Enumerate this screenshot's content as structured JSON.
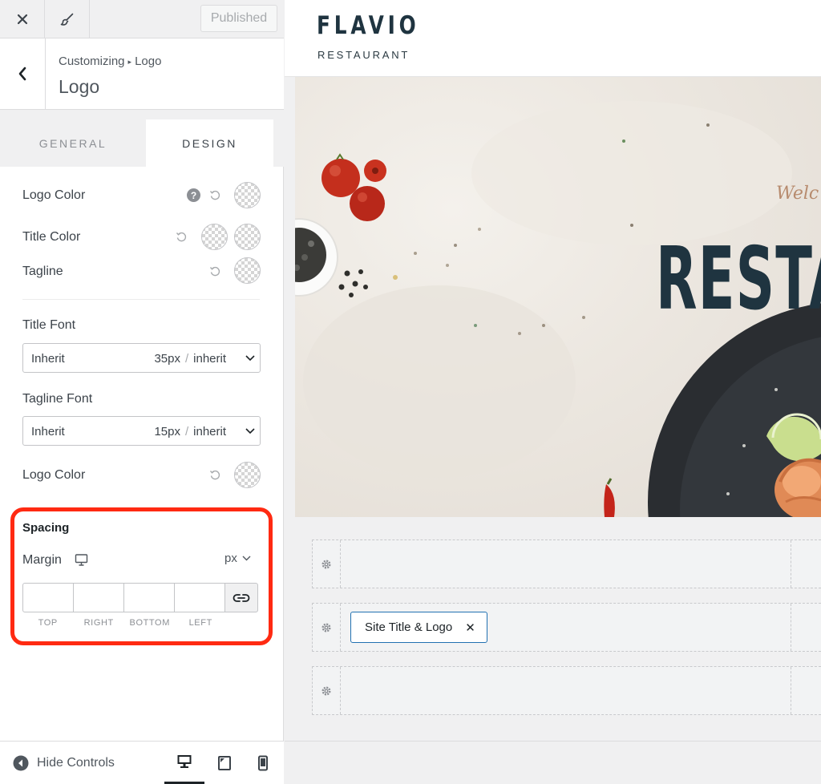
{
  "topbar": {
    "publish_label": "Published"
  },
  "section": {
    "breadcrumb_parent": "Customizing",
    "breadcrumb_sep": "▸",
    "breadcrumb_child": "Logo",
    "title": "Logo"
  },
  "tabs": {
    "general": "GENERAL",
    "design": "DESIGN",
    "active": "DESIGN"
  },
  "controls": {
    "logo_color_label": "Logo Color",
    "title_color_label": "Title Color",
    "tagline_label": "Tagline",
    "title_font_label": "Title Font",
    "title_font": {
      "family": "Inherit",
      "size": "35px",
      "slash": "/",
      "line_height": "inherit"
    },
    "tagline_font_label": "Tagline Font",
    "tagline_font": {
      "family": "Inherit",
      "size": "15px",
      "slash": "/",
      "line_height": "inherit"
    },
    "logo_color2_label": "Logo Color",
    "help_glyph": "?"
  },
  "spacing": {
    "title": "Spacing",
    "margin_label": "Margin",
    "unit": "px",
    "top": "",
    "right": "",
    "bottom": "",
    "left": "",
    "captions": [
      "TOP",
      "RIGHT",
      "BOTTOM",
      "LEFT"
    ],
    "highlight_color": "#ff2a12"
  },
  "footer": {
    "hide_controls_label": "Hide Controls",
    "active_device": "desktop"
  },
  "preview": {
    "site_title": "FLAVIO",
    "site_tagline": "RESTAURANT",
    "hero_script": "Welc",
    "hero_heading": "RESTA",
    "chip_label": "Site Title & Logo",
    "chip_close": "✕",
    "accent_color": "#1f3440"
  }
}
